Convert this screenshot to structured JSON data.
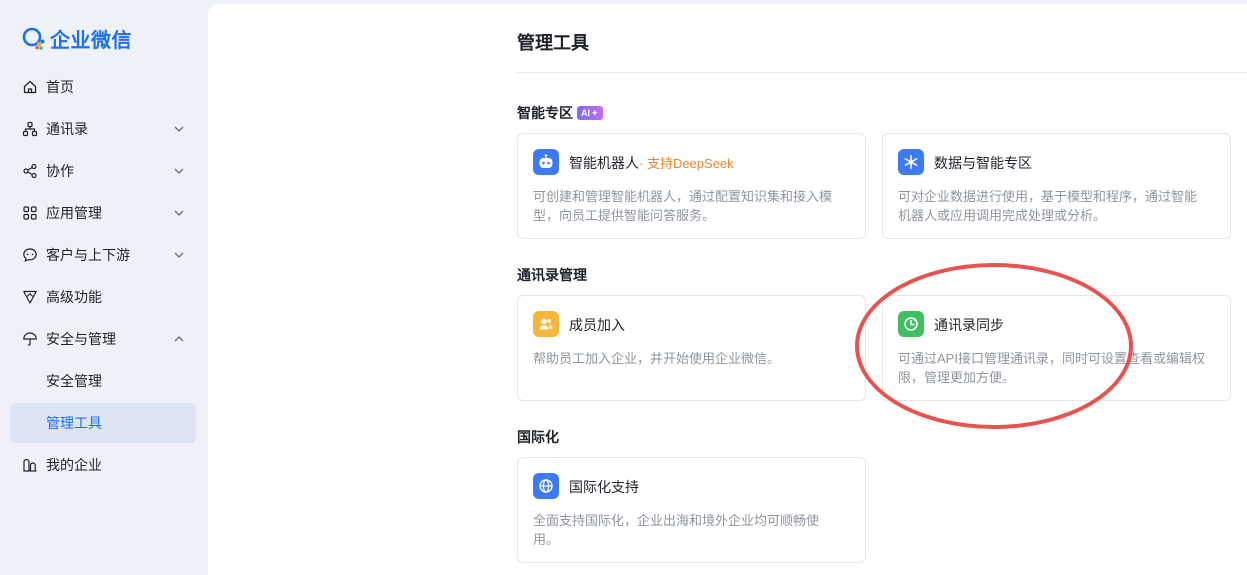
{
  "app": {
    "name": "企业微信"
  },
  "sidebar": {
    "items": [
      {
        "label": "首页",
        "icon": "home-icon"
      },
      {
        "label": "通讯录",
        "icon": "org-chart-icon",
        "expand": "chevron-down-icon"
      },
      {
        "label": "协作",
        "icon": "share-icon",
        "expand": "chevron-down-icon"
      },
      {
        "label": "应用管理",
        "icon": "grid-icon",
        "expand": "chevron-down-icon"
      },
      {
        "label": "客户与上下游",
        "icon": "chat-icon",
        "expand": "chevron-down-icon"
      },
      {
        "label": "高级功能",
        "icon": "funnel-icon"
      },
      {
        "label": "安全与管理",
        "icon": "umbrella-icon",
        "expand": "chevron-up-icon"
      },
      {
        "label": "安全管理"
      },
      {
        "label": "管理工具",
        "active": true
      },
      {
        "label": "我的企业",
        "icon": "building-icon"
      }
    ]
  },
  "main": {
    "title": "管理工具",
    "sections": [
      {
        "title": "智能专区",
        "badge": "AI"
      },
      {
        "title": "通讯录管理"
      },
      {
        "title": "国际化"
      }
    ],
    "cards": {
      "robot": {
        "title": "智能机器人",
        "subtitle": "· 支持DeepSeek",
        "desc": "可创建和管理智能机器人，通过配置知识集和接入模型，向员工提供智能问答服务。",
        "icon": "robot-icon"
      },
      "data": {
        "title": "数据与智能专区",
        "desc": "可对企业数据进行使用，基于模型和程序，通过智能机器人或应用调用完成处理或分析。",
        "icon": "data-snowflake-icon"
      },
      "member": {
        "title": "成员加入",
        "desc": "帮助员工加入企业，并开始使用企业微信。",
        "icon": "members-icon"
      },
      "sync": {
        "title": "通讯录同步",
        "desc": "可通过API接口管理通讯录，同时可设置查看或编辑权限，管理更加方便。",
        "icon": "sync-icon"
      },
      "intl": {
        "title": "国际化支持",
        "desc": "全面支持国际化，企业出海和境外企业均可顺畅使用。",
        "icon": "globe-icon"
      }
    }
  },
  "colors": {
    "accent": "#1d6ff2",
    "annotation": "#e8534f",
    "deepseek": "#f0842c"
  }
}
